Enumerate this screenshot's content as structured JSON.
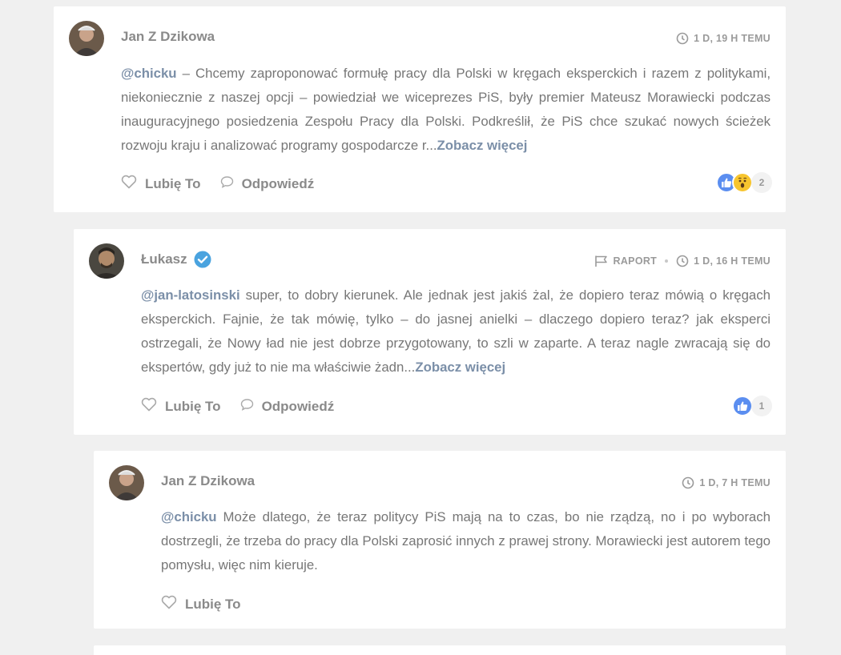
{
  "comments": [
    {
      "author": "Jan Z Dzikowa",
      "timestamp": "1 D, 19 H TEMU",
      "mention": "@chicku",
      "text": " – Chcemy zaproponować formułę pracy dla Polski w kręgach eksperckich i razem z politykami, niekoniecznie z naszej opcji – powiedział we wiceprezes PiS, były premier Mateusz Morawiecki podczas inauguracyjnego posiedzenia Zespołu Pracy dla Polski. Podkreślił, że PiS chce szukać nowych ścieżek rozwoju kraju i analizować programy gospodarcze r...",
      "more_label": "Zobacz więcej",
      "like_label": "Lubię To",
      "reply_label": "Odpowiedź",
      "reaction_count": "2",
      "reactions": [
        "like",
        "wow"
      ]
    },
    {
      "author": "Łukasz",
      "verified": true,
      "report_label": "RAPORT",
      "timestamp": "1 D, 16 H TEMU",
      "mention": "@jan-latosinski",
      "text": " super, to dobry kierunek. Ale jednak jest jakiś żal, że dopiero teraz mówią o kręgach eksperckich. Fajnie, że tak mówię, tylko – do jasnej anielki – dlaczego dopiero teraz? jak eksperci ostrzegali, że Nowy ład nie jest dobrze przygotowany, to szli w zaparte. A teraz nagle zwracają się do ekspertów, gdy już to nie ma właściwie żadn...",
      "more_label": "Zobacz więcej",
      "like_label": "Lubię To",
      "reply_label": "Odpowiedź",
      "reaction_count": "1",
      "reactions": [
        "like"
      ]
    },
    {
      "author": "Jan Z Dzikowa",
      "timestamp": "1 D, 7 H TEMU",
      "mention": "@chicku",
      "text": " Może dlatego, że teraz politycy PiS mają na to czas, bo nie rządzą, no i po wyborach dostrzegli, że trzeba do pracy dla Polski zaprosić innych z prawej strony. Morawiecki jest autorem tego pomysłu, więc nim kieruje.",
      "like_label": "Lubię To"
    }
  ],
  "colors": {
    "background": "#f0f0f0",
    "card": "#ffffff",
    "mention": "#7b8fa8",
    "verified": "#4aa3df",
    "like_reaction": "#5b8ef0",
    "wow_reaction": "#f7c52f"
  },
  "icons": {
    "clock": "clock-icon",
    "flag": "flag-icon",
    "heart": "heart-outline-icon",
    "reply": "speech-bubble-icon",
    "verified": "verified-check-icon"
  }
}
